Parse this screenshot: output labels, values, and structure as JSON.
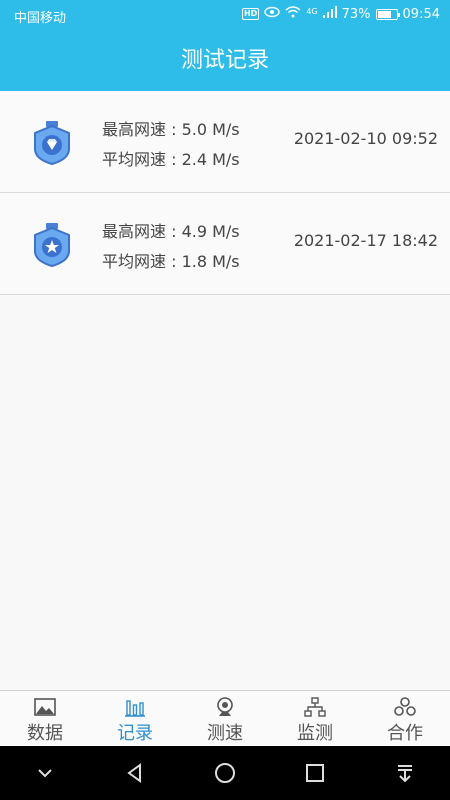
{
  "status": {
    "carrier": "中国移动",
    "hd": "HD",
    "network": "4G",
    "battery_pct": "73%",
    "battery_level": 0.73,
    "time": "09:54"
  },
  "header": {
    "title": "测试记录"
  },
  "records": [
    {
      "max_speed": "最高网速 : 5.0 M/s",
      "avg_speed": "平均网速 : 2.4 M/s",
      "datetime": "2021-02-10 09:52",
      "badge_icon": "medal-diamond-icon"
    },
    {
      "max_speed": "最高网速 : 4.9 M/s",
      "avg_speed": "平均网速 : 1.8 M/s",
      "datetime": "2021-02-17 18:42",
      "badge_icon": "medal-star-icon"
    }
  ],
  "tabs": [
    {
      "label": "数据",
      "icon": "image-icon",
      "active": false
    },
    {
      "label": "记录",
      "icon": "bar-chart-icon",
      "active": true
    },
    {
      "label": "测速",
      "icon": "webcam-icon",
      "active": false
    },
    {
      "label": "监测",
      "icon": "network-icon",
      "active": false
    },
    {
      "label": "合作",
      "icon": "team-icon",
      "active": false
    }
  ],
  "colors": {
    "primary": "#2dbde8",
    "active_tab": "#2f8fd0"
  }
}
